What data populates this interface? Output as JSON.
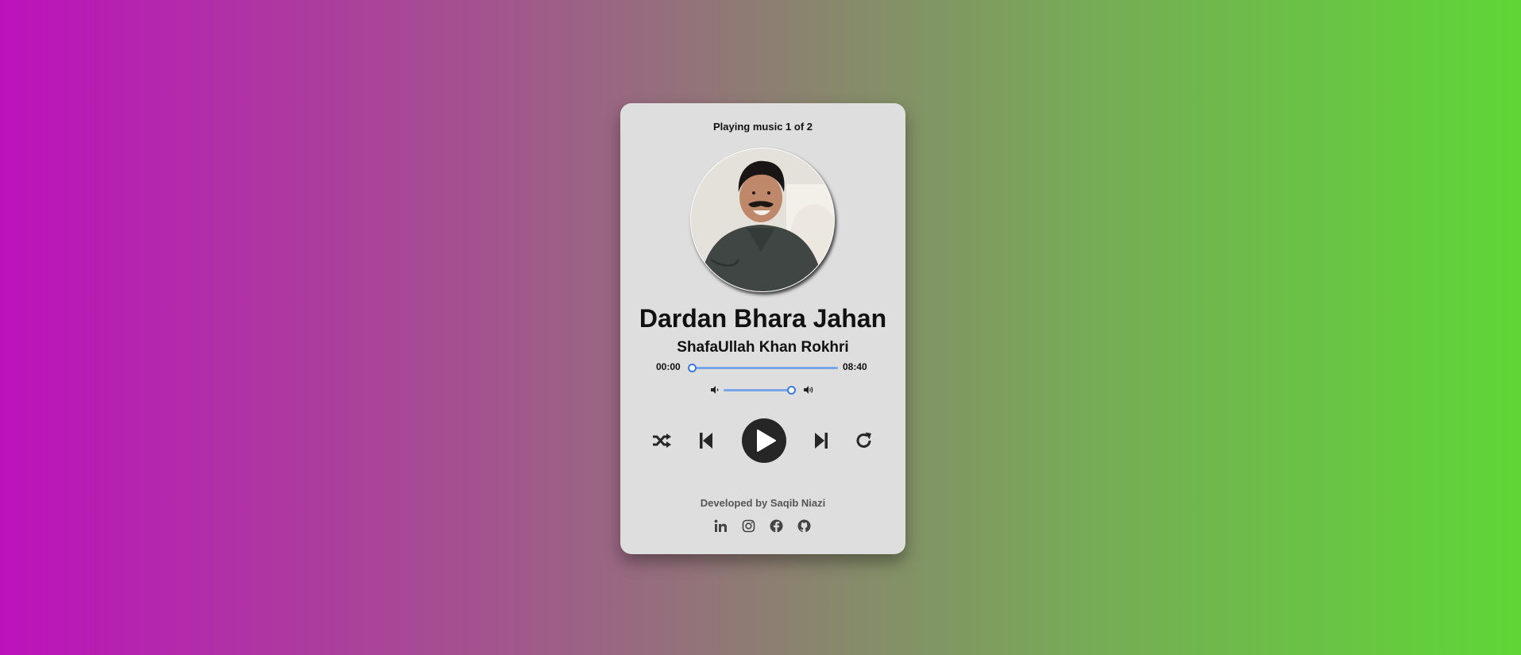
{
  "player": {
    "counter": "Playing music 1 of 2",
    "track_title": "Dardan Bhara Jahan",
    "artist": "ShafaUllah Khan Rokhri",
    "current_time": "00:00",
    "duration": "08:40",
    "seek_progress": 0,
    "volume_level": 1.0
  },
  "controls": {
    "shuffle_icon": "shuffle-icon",
    "previous_icon": "skip-back-icon",
    "play_icon": "play-icon",
    "next_icon": "skip-forward-icon",
    "repeat_icon": "repeat-icon"
  },
  "footer": {
    "developer_text": "Developed by Saqib Niazi",
    "social_icons": [
      "linkedin-icon",
      "instagram-icon",
      "facebook-icon",
      "github-icon"
    ]
  },
  "colors": {
    "background_start": "#bc12bb",
    "background_end": "#5fd636",
    "card": "#dedede",
    "accent": "#3d79e1",
    "play_button": "#262626"
  }
}
